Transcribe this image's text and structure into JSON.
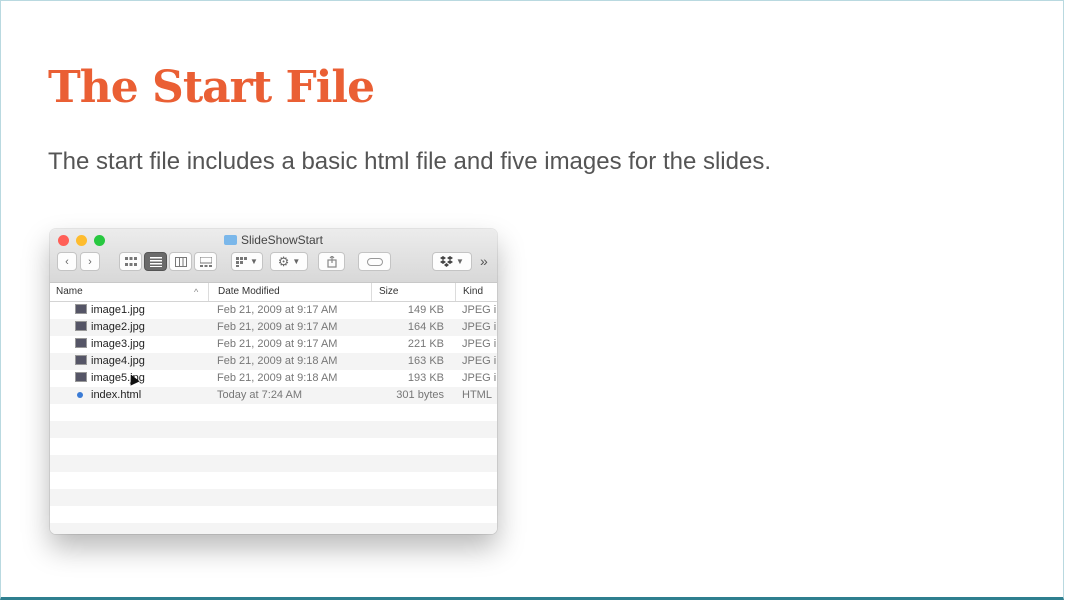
{
  "slide": {
    "title": "The Start File",
    "text": "The start file includes a basic html file and five images for the slides."
  },
  "finder": {
    "window_title": "SlideShowStart",
    "columns": {
      "name": "Name",
      "date": "Date Modified",
      "size": "Size",
      "kind": "Kind"
    },
    "files": [
      {
        "name": "image1.jpg",
        "date": "Feb 21, 2009 at 9:17 AM",
        "size": "149 KB",
        "kind": "JPEG i"
      },
      {
        "name": "image2.jpg",
        "date": "Feb 21, 2009 at 9:17 AM",
        "size": "164 KB",
        "kind": "JPEG i"
      },
      {
        "name": "image3.jpg",
        "date": "Feb 21, 2009 at 9:17 AM",
        "size": "221 KB",
        "kind": "JPEG i"
      },
      {
        "name": "image4.jpg",
        "date": "Feb 21, 2009 at 9:18 AM",
        "size": "163 KB",
        "kind": "JPEG i"
      },
      {
        "name": "image5.jpg",
        "date": "Feb 21, 2009 at 9:18 AM",
        "size": "193 KB",
        "kind": "JPEG i"
      },
      {
        "name": "index.html",
        "date": "Today at 7:24 AM",
        "size": "301 bytes",
        "kind": "HTML"
      }
    ],
    "toolbar": {
      "back_glyph": "‹",
      "forward_glyph": "›",
      "more_glyph": "»"
    }
  }
}
